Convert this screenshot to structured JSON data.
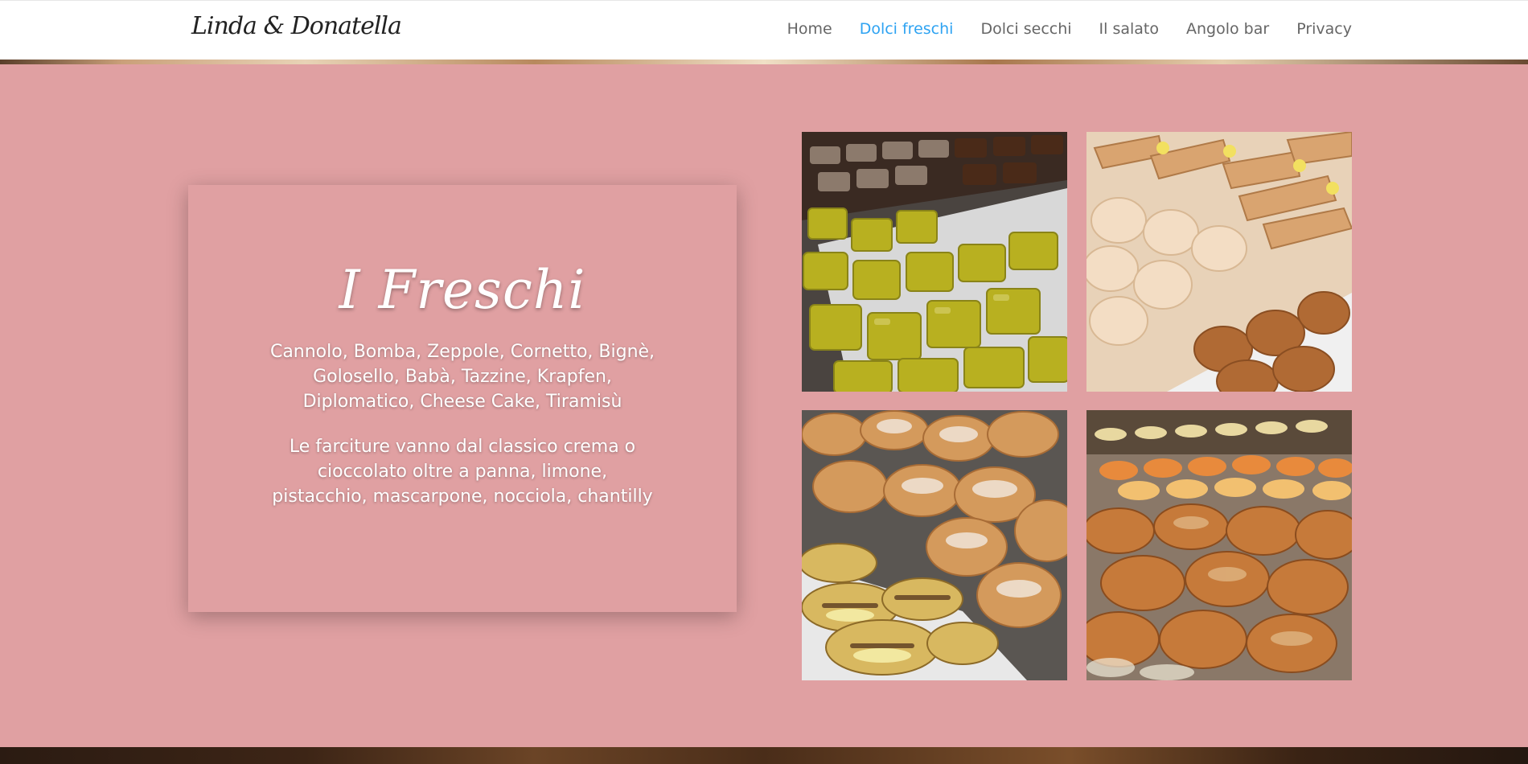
{
  "header": {
    "logo_text": "Linda & Donatella",
    "nav": [
      {
        "label": "Home",
        "active": false
      },
      {
        "label": "Dolci freschi",
        "active": true
      },
      {
        "label": "Dolci secchi",
        "active": false
      },
      {
        "label": "Il salato",
        "active": false
      },
      {
        "label": "Angolo bar",
        "active": false
      },
      {
        "label": "Privacy",
        "active": false
      }
    ]
  },
  "card": {
    "title": "I Freschi",
    "list_text": "Cannolo, Bomba, Zeppole, Cornetto, Bignè, Golosello, Babà, Tazzine, Krapfen, Diplomatico, Cheese Cake, Tiramisù",
    "description": "Le farciture vanno dal classico crema o cioccolato oltre a panna, limone, pistacchio, mascarpone, nocciola, chantilly"
  },
  "photos": [
    {
      "name": "pistachio-cakes-photo"
    },
    {
      "name": "cannoli-and-bombe-photo"
    },
    {
      "name": "croissants-photo"
    },
    {
      "name": "zeppole-photo"
    }
  ],
  "colors": {
    "background": "#e0a0a2",
    "nav_text": "#666666",
    "nav_active": "#2ea3f2",
    "header_bg": "#ffffff",
    "card_text": "#ffffff"
  }
}
